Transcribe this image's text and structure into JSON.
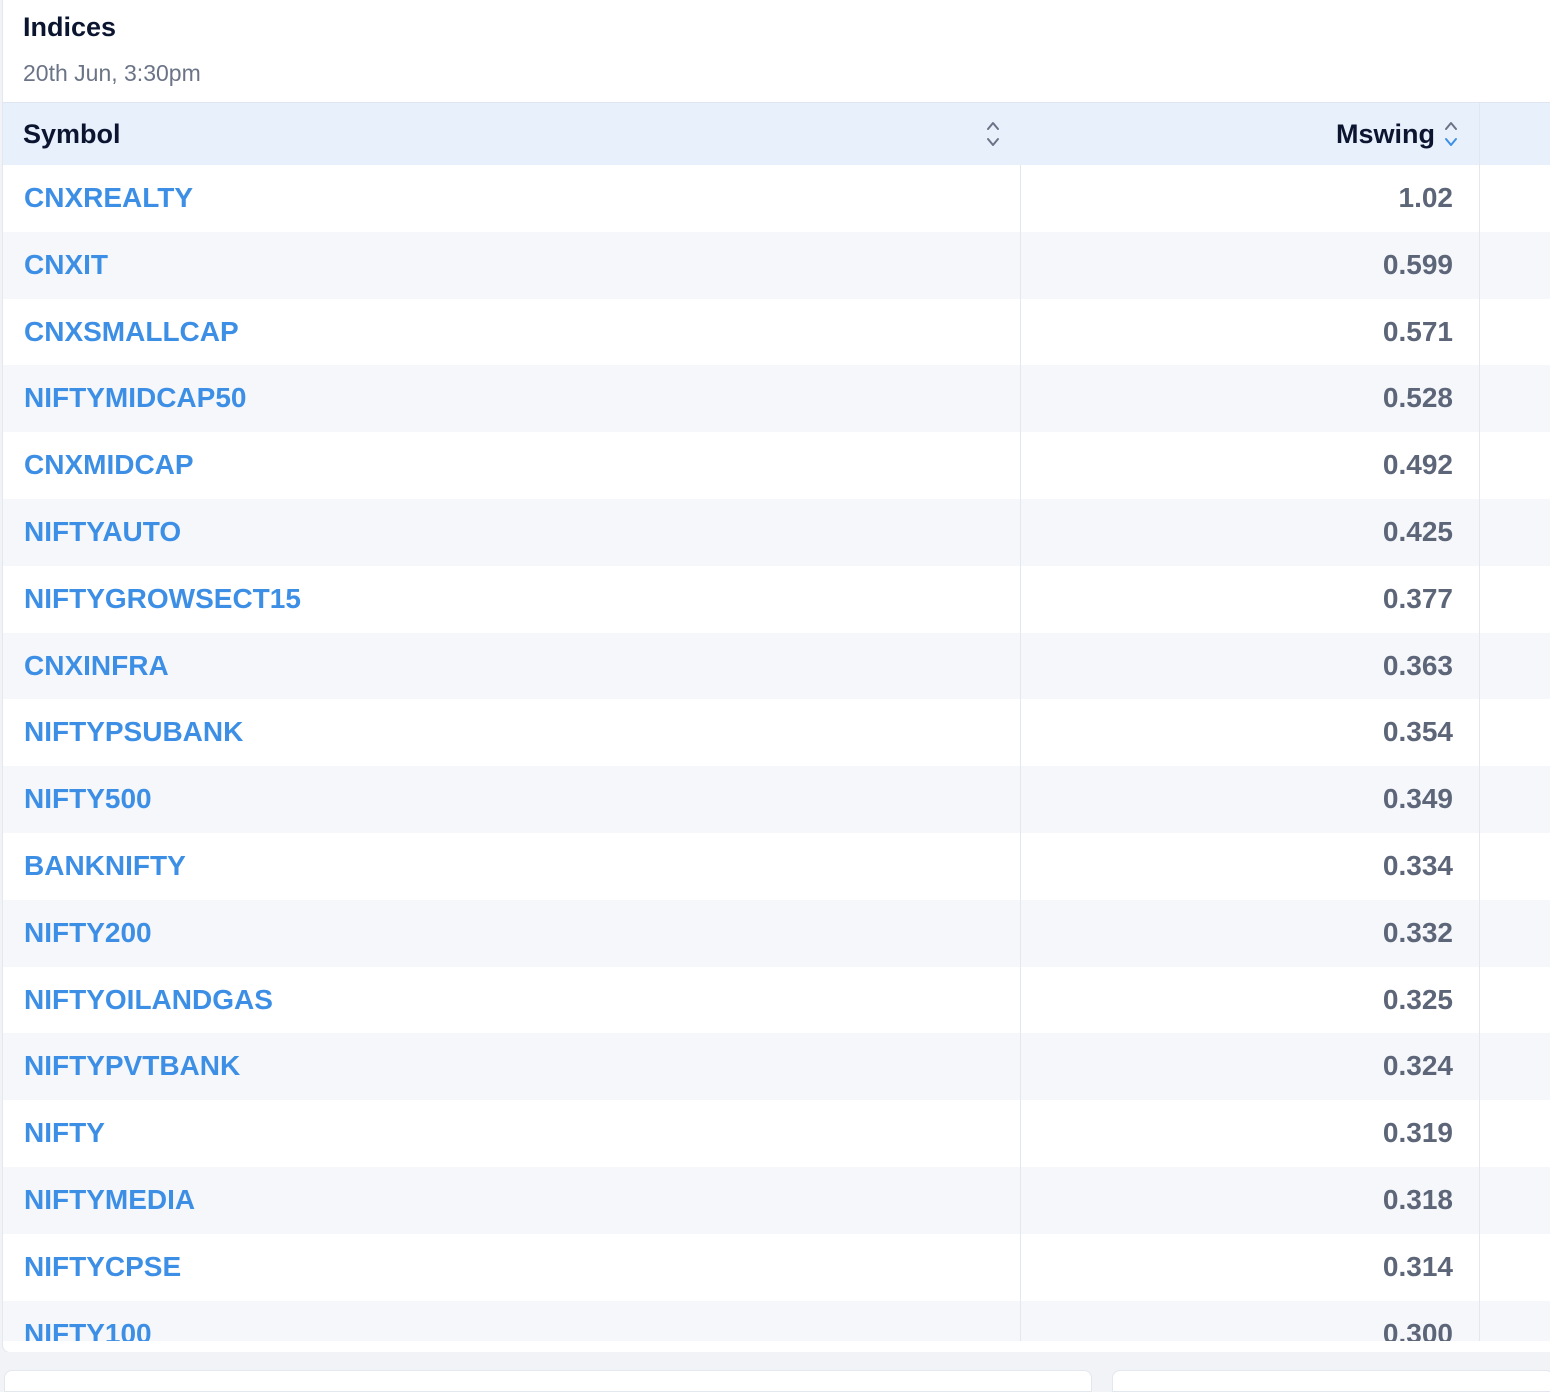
{
  "header": {
    "title": "Indices",
    "subtitle": "20th Jun, 3:30pm"
  },
  "table": {
    "columns": [
      {
        "label": "Symbol",
        "sort_icon": "sort-neutral-icon"
      },
      {
        "label": "Mswing",
        "sort_icon": "sort-descending-icon"
      }
    ],
    "rows": [
      {
        "symbol": "CNXREALTY",
        "mswing": "1.02"
      },
      {
        "symbol": "CNXIT",
        "mswing": "0.599"
      },
      {
        "symbol": "CNXSMALLCAP",
        "mswing": "0.571"
      },
      {
        "symbol": "NIFTYMIDCAP50",
        "mswing": "0.528"
      },
      {
        "symbol": "CNXMIDCAP",
        "mswing": "0.492"
      },
      {
        "symbol": "NIFTYAUTO",
        "mswing": "0.425"
      },
      {
        "symbol": "NIFTYGROWSECT15",
        "mswing": "0.377"
      },
      {
        "symbol": "CNXINFRA",
        "mswing": "0.363"
      },
      {
        "symbol": "NIFTYPSUBANK",
        "mswing": "0.354"
      },
      {
        "symbol": "NIFTY500",
        "mswing": "0.349"
      },
      {
        "symbol": "BANKNIFTY",
        "mswing": "0.334"
      },
      {
        "symbol": "NIFTY200",
        "mswing": "0.332"
      },
      {
        "symbol": "NIFTYOILANDGAS",
        "mswing": "0.325"
      },
      {
        "symbol": "NIFTYPVTBANK",
        "mswing": "0.324"
      },
      {
        "symbol": "NIFTY",
        "mswing": "0.319"
      },
      {
        "symbol": "NIFTYMEDIA",
        "mswing": "0.318"
      },
      {
        "symbol": "NIFTYCPSE",
        "mswing": "0.314"
      },
      {
        "symbol": "NIFTY100",
        "mswing": "0.300"
      }
    ]
  },
  "colors": {
    "link": "#3d8fe6",
    "header_bg": "#e8f0fc",
    "alt_row_bg": "#f5f7fb",
    "value_text": "#5d6678",
    "sort_active": "#3d8fe6",
    "sort_inactive": "#6b7487"
  }
}
